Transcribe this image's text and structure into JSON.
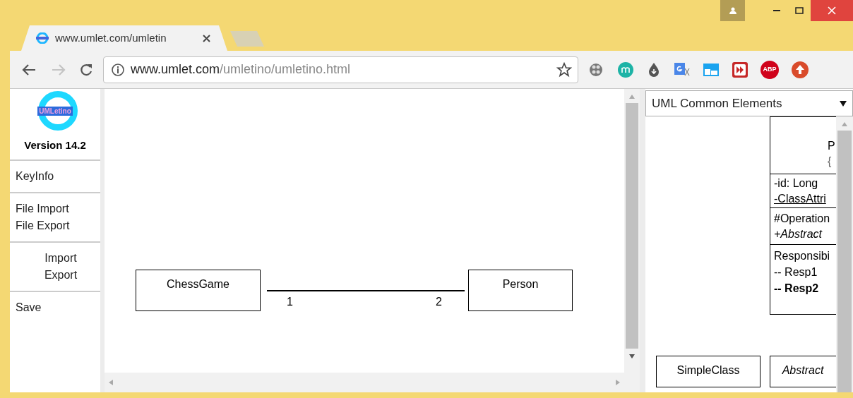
{
  "tabs": [
    {
      "title": "www.umlet.com/umletin",
      "selected": true
    }
  ],
  "adblock_badge": "ABP",
  "address": {
    "host": "www.umlet.com",
    "path": "/umletino/umletino.html"
  },
  "sidebar": {
    "logo": "UMLetino",
    "version": "Version 14.2",
    "groups": [
      {
        "items": [
          "KeyInfo"
        ],
        "centered": false
      },
      {
        "items": [
          "File Import",
          "File Export"
        ],
        "centered": false
      },
      {
        "items": [
          "Import",
          "Export"
        ],
        "centered": true
      },
      {
        "items": [
          "Save"
        ],
        "centered": false
      }
    ]
  },
  "diagram": {
    "classes": [
      {
        "name": "ChessGame"
      },
      {
        "name": "Person"
      }
    ],
    "association": {
      "left_multiplicity": "1",
      "right_multiplicity": "2"
    }
  },
  "palette": {
    "dropdown": "UML Common Elements",
    "class_box": {
      "name": "P",
      "properties": "{",
      "attributes": [
        {
          "text": "-id: Long",
          "static": false
        },
        {
          "text": "-ClassAttri",
          "static": true
        }
      ],
      "operations": [
        {
          "text": "#Operation",
          "abstract": false
        },
        {
          "text": "+Abstract",
          "abstract": true
        }
      ],
      "responsibilities": [
        {
          "text": "Responsibi",
          "bold": false
        },
        {
          "text": "-- Resp1",
          "bold": false
        },
        {
          "text": "-- Resp2",
          "bold": true
        }
      ]
    },
    "elements": [
      {
        "name": "SimpleClass",
        "abstract": false
      },
      {
        "name": "Abstract",
        "abstract": true
      }
    ]
  }
}
